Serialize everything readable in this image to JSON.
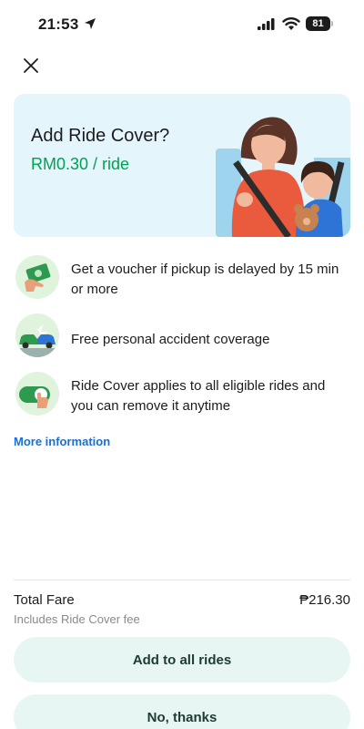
{
  "status_bar": {
    "time": "21:53",
    "battery": "81"
  },
  "hero": {
    "title": "Add Ride Cover?",
    "price": "RM0.30 / ride"
  },
  "benefits": [
    {
      "icon": "voucher-icon",
      "text": "Get a voucher if pickup is delayed by 15 min or more"
    },
    {
      "icon": "accident-car-icon",
      "text": "Free personal accident coverage"
    },
    {
      "icon": "toggle-switch-icon",
      "text": "Ride Cover applies to all eligible rides and you can remove it anytime"
    }
  ],
  "more_info_label": "More information",
  "fare": {
    "label": "Total Fare",
    "sub": "Includes Ride Cover fee",
    "value": "₱216.30"
  },
  "buttons": {
    "primary": "Add to all rides",
    "secondary": "No, thanks"
  },
  "colors": {
    "accent_green": "#00a251",
    "link_blue": "#1a6fd1",
    "hero_bg": "#e4f5fc",
    "button_bg": "#e8f6f3"
  }
}
